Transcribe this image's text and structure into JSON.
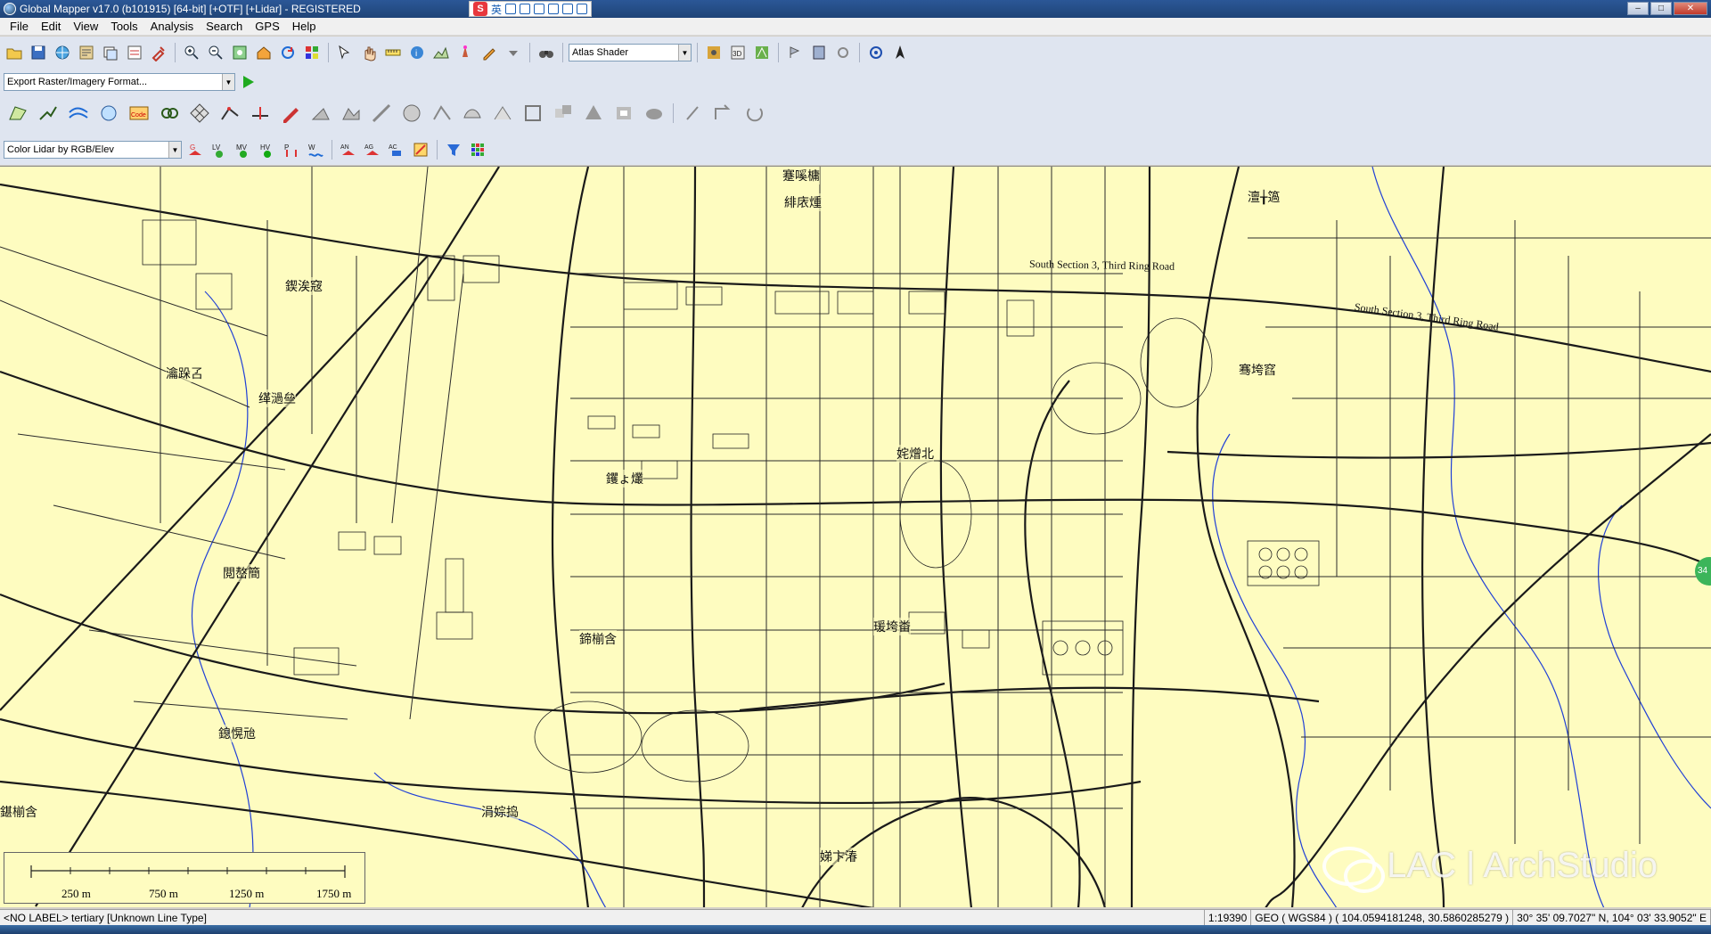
{
  "window": {
    "title": "Global Mapper v17.0 (b101915) [64-bit] [+OTF] [+Lidar] - REGISTERED",
    "minimize_label": "–",
    "maximize_label": "□",
    "close_label": "✕"
  },
  "ime": {
    "label": "英"
  },
  "menu": [
    "File",
    "Edit",
    "View",
    "Tools",
    "Analysis",
    "Search",
    "GPS",
    "Help"
  ],
  "toolbar": {
    "shader_select": "Atlas Shader",
    "export_select": "Export Raster/Imagery Format...",
    "lidar_select": "Color Lidar by RGB/Elev"
  },
  "colors": {
    "map_background": "#fefcc0",
    "road_color": "#1a1a1a",
    "water_color": "#1f3fd6",
    "title_bar": "#2b5797"
  },
  "map": {
    "road_labels": [
      "South Section 3, Third Ring Road",
      "South Section 3, Third Ring Road"
    ],
    "labels": [
      "蹇嗘槦",
      "緋庡煄",
      "澶╁簻",
      "鍥涘窛",
      "瀹跺叾",
      "缂濄亝",
      "钁ょ爜",
      "姹熷北",
      "閲嶅簡",
      "鍗椾含",
      "瑗垮畨",
      "鎴愰兘",
      "涓婃捣",
      "鍖椾含",
      "骞垮窞",
      "娣卞湷"
    ],
    "scale": {
      "ticks": [
        "250 m",
        "750 m",
        "1250 m",
        "1750 m"
      ]
    },
    "watermark": "LAC | ArchStudio",
    "badge": "34"
  },
  "status": {
    "layer": "<NO LABEL> tertiary [Unknown Line Type]",
    "scale": "1:19390",
    "projection": "GEO ( WGS84 ) ( 104.0594181248, 30.5860285279 )",
    "coords": "30° 35' 09.7027\" N, 104° 03' 33.9052\" E"
  }
}
